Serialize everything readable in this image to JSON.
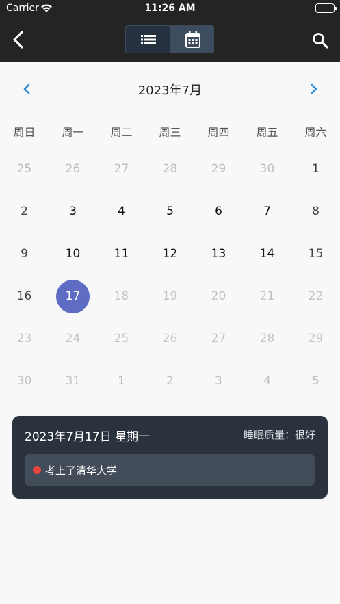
{
  "status_bar": {
    "carrier": "Carrier",
    "time": "11:26 AM"
  },
  "nav": {
    "back_icon": "chevron-left-icon",
    "toggle": [
      {
        "icon": "list-icon",
        "selected": false
      },
      {
        "icon": "calendar-icon",
        "selected": true
      }
    ],
    "search_icon": "search-icon"
  },
  "calendar": {
    "month_label": "2023年7月",
    "weekdays": [
      "周日",
      "周一",
      "周二",
      "周三",
      "周四",
      "周五",
      "周六"
    ],
    "weeks": [
      [
        "25",
        "26",
        "27",
        "28",
        "29",
        "30",
        "1"
      ],
      [
        "2",
        "3",
        "4",
        "5",
        "6",
        "7",
        "8"
      ],
      [
        "9",
        "10",
        "11",
        "12",
        "13",
        "14",
        "15"
      ],
      [
        "16",
        "17",
        "18",
        "19",
        "20",
        "21",
        "22"
      ],
      [
        "23",
        "24",
        "25",
        "26",
        "27",
        "28",
        "29"
      ],
      [
        "30",
        "31",
        "1",
        "2",
        "3",
        "4",
        "5"
      ]
    ],
    "selected": "17"
  },
  "detail": {
    "date": "2023年7月17日 星期一",
    "sleep_quality": "睡眠质量：很好",
    "event": "考上了清华大学",
    "event_color": "#e8433f"
  },
  "colors": {
    "header_bg": "#242424",
    "accent": "#5f6cc4",
    "arrow": "#2d8bd6",
    "card_bg": "#29323d"
  }
}
